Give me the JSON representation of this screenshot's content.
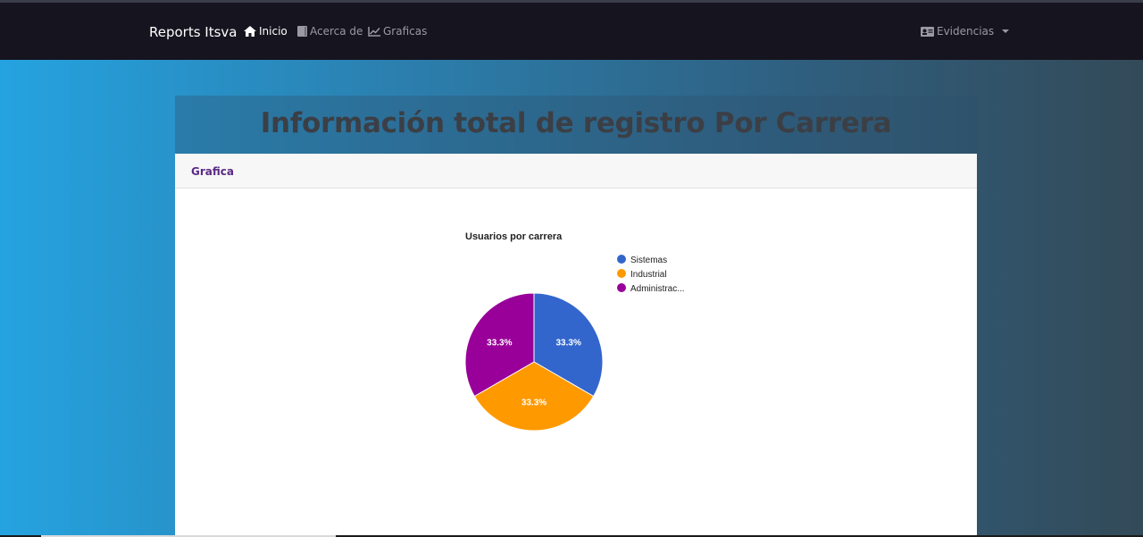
{
  "navbar": {
    "brand": "Reports Itsva",
    "items": [
      {
        "label": "Inicio",
        "icon": "home-icon",
        "active": true
      },
      {
        "label": "Acerca de",
        "icon": "book-icon",
        "active": false
      },
      {
        "label": "Graficas",
        "icon": "line-chart-icon",
        "active": false
      }
    ],
    "dropdown": {
      "label": "Evidencias",
      "icon": "id-card-icon"
    }
  },
  "page": {
    "heading": "Información total de registro Por Carrera"
  },
  "card": {
    "header": "Grafica"
  },
  "chart_data": {
    "type": "pie",
    "title": "Usuarios por carrera",
    "categories": [
      "Sistemas",
      "Industrial",
      "Administrac..."
    ],
    "values": [
      1,
      1,
      1
    ],
    "labels": [
      "33.3%",
      "33.3%",
      "33.3%"
    ],
    "colors": [
      "#3366cc",
      "#ff9900",
      "#990099"
    ],
    "legend": "right"
  },
  "colors": {
    "navbar_bg": "#16141f",
    "card_header_text": "#5b2a86"
  }
}
